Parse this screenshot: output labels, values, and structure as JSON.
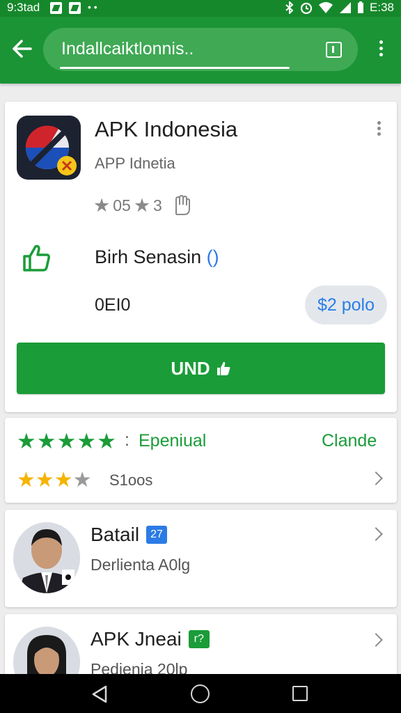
{
  "status_bar": {
    "time": "9:3tad",
    "battery_time": "E:38",
    "icons": [
      "notification-icon",
      "image-icon",
      "bluetooth-icon",
      "alarm-icon",
      "wifi-icon",
      "signal-icon",
      "battery-icon"
    ]
  },
  "app_bar": {
    "search_text": "Indallcaiktlonnis..",
    "icons": [
      "back-arrow-icon",
      "window-icon",
      "overflow-menu-icon"
    ]
  },
  "app_card": {
    "title": "APK Indonesia",
    "subtitle": "APP Idnetia",
    "rating_value": "05",
    "rating_count": "3",
    "feature_label": "Birh Senasin",
    "feature_paren": "()",
    "size": "0EI0",
    "price": "$2 polo",
    "install_label": "UND",
    "icons": [
      "app-icon",
      "star-icon",
      "hand-icon",
      "thumbs-up-icon"
    ]
  },
  "rating_card": {
    "green_stars": 5,
    "label": "Epeniual",
    "change_label": "Clande",
    "yellow_stars": 3,
    "total_stars": 4,
    "reviews_text": "S1oos"
  },
  "developers": [
    {
      "name": "Batail",
      "badge": "27",
      "badge_color": "#2c7be5",
      "role": "Derlienta A0lg"
    },
    {
      "name": "APK Jneai",
      "badge": "r?",
      "badge_color": "#1a9c38",
      "role": "Pedienia 20lp"
    }
  ],
  "colors": {
    "primary_green": "#1b9436",
    "accent_blue": "#2a7ee8",
    "star_yellow": "#f5b400"
  }
}
